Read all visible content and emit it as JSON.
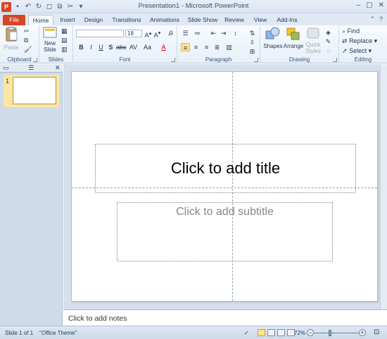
{
  "window": {
    "title": "Presentation1 - Microsoft PowerPoint"
  },
  "tabs": [
    {
      "label": "File"
    },
    {
      "label": "Home"
    },
    {
      "label": "Insert"
    },
    {
      "label": "Design"
    },
    {
      "label": "Transitions"
    },
    {
      "label": "Animations"
    },
    {
      "label": "Slide Show"
    },
    {
      "label": "Review"
    },
    {
      "label": "View"
    },
    {
      "label": "Add-Ins"
    }
  ],
  "ribbon": {
    "clipboard": {
      "label": "Clipboard",
      "paste": "Paste"
    },
    "slides": {
      "label": "Slides",
      "new_slide_line1": "New",
      "new_slide_line2": "Slide"
    },
    "font": {
      "label": "Font",
      "font_name": "",
      "font_size": "18"
    },
    "paragraph": {
      "label": "Paragraph"
    },
    "drawing": {
      "label": "Drawing",
      "shapes": "Shapes",
      "arrange": "Arrange",
      "quick_styles_line1": "Quick",
      "quick_styles_line2": "Styles"
    },
    "editing": {
      "label": "Editing",
      "find": "Find",
      "replace": "Replace",
      "select": "Select"
    }
  },
  "thumbnails": [
    {
      "number": "1"
    }
  ],
  "slide": {
    "title_placeholder": "Click to add title",
    "subtitle_placeholder": "Click to add subtitle"
  },
  "notes": {
    "placeholder": "Click to add notes"
  },
  "status": {
    "slide_info": "Slide 1 of 1",
    "theme": "\"Office Theme\"",
    "zoom": "72%",
    "zoom_level": 0.72
  },
  "colors": {
    "file_tab": "#d24726",
    "selected_thumb": "#fbe6a3",
    "ribbon_bg": "#e8eff8"
  }
}
